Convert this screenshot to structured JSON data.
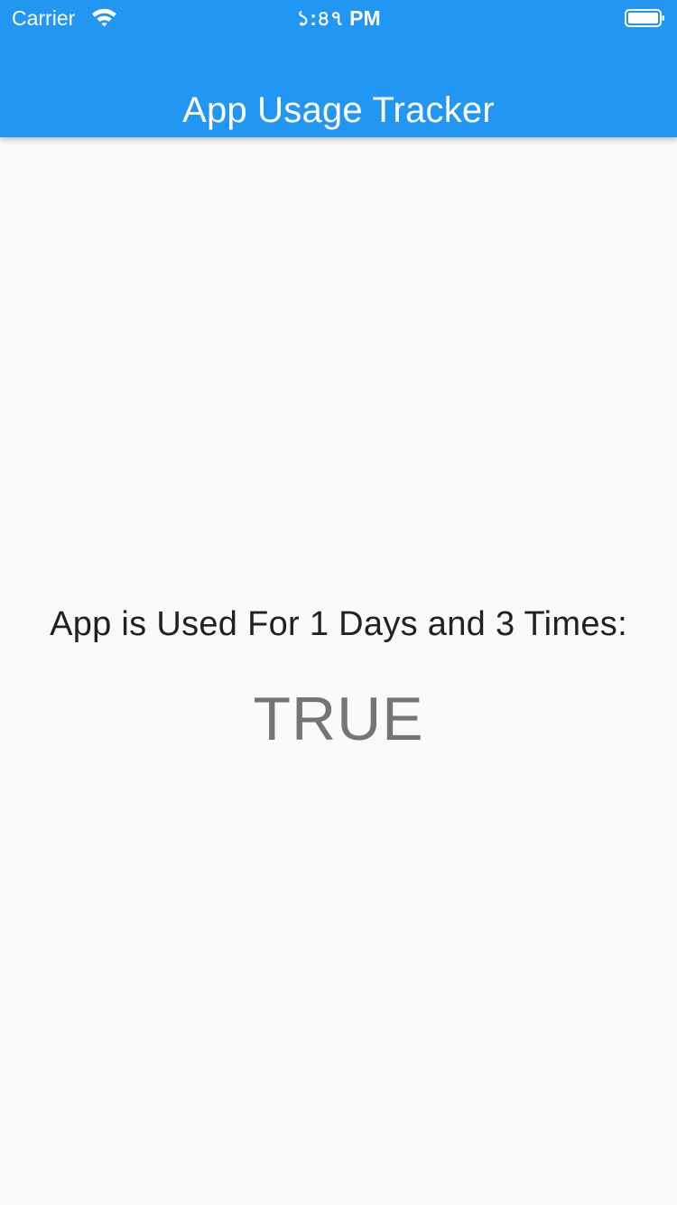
{
  "status_bar": {
    "carrier": "Carrier",
    "time": "১:৪৭ PM",
    "wifi_icon": "wifi-icon",
    "battery_icon": "battery-icon"
  },
  "app_bar": {
    "title": "App Usage Tracker",
    "background_color": "#2196f3"
  },
  "main": {
    "usage_message": "App is Used For 1 Days and 3 Times:",
    "result_value": "TRUE"
  },
  "colors": {
    "background": "#fafafa",
    "accent": "#2196f3",
    "primary_text": "#212121",
    "secondary_text": "#757575"
  }
}
